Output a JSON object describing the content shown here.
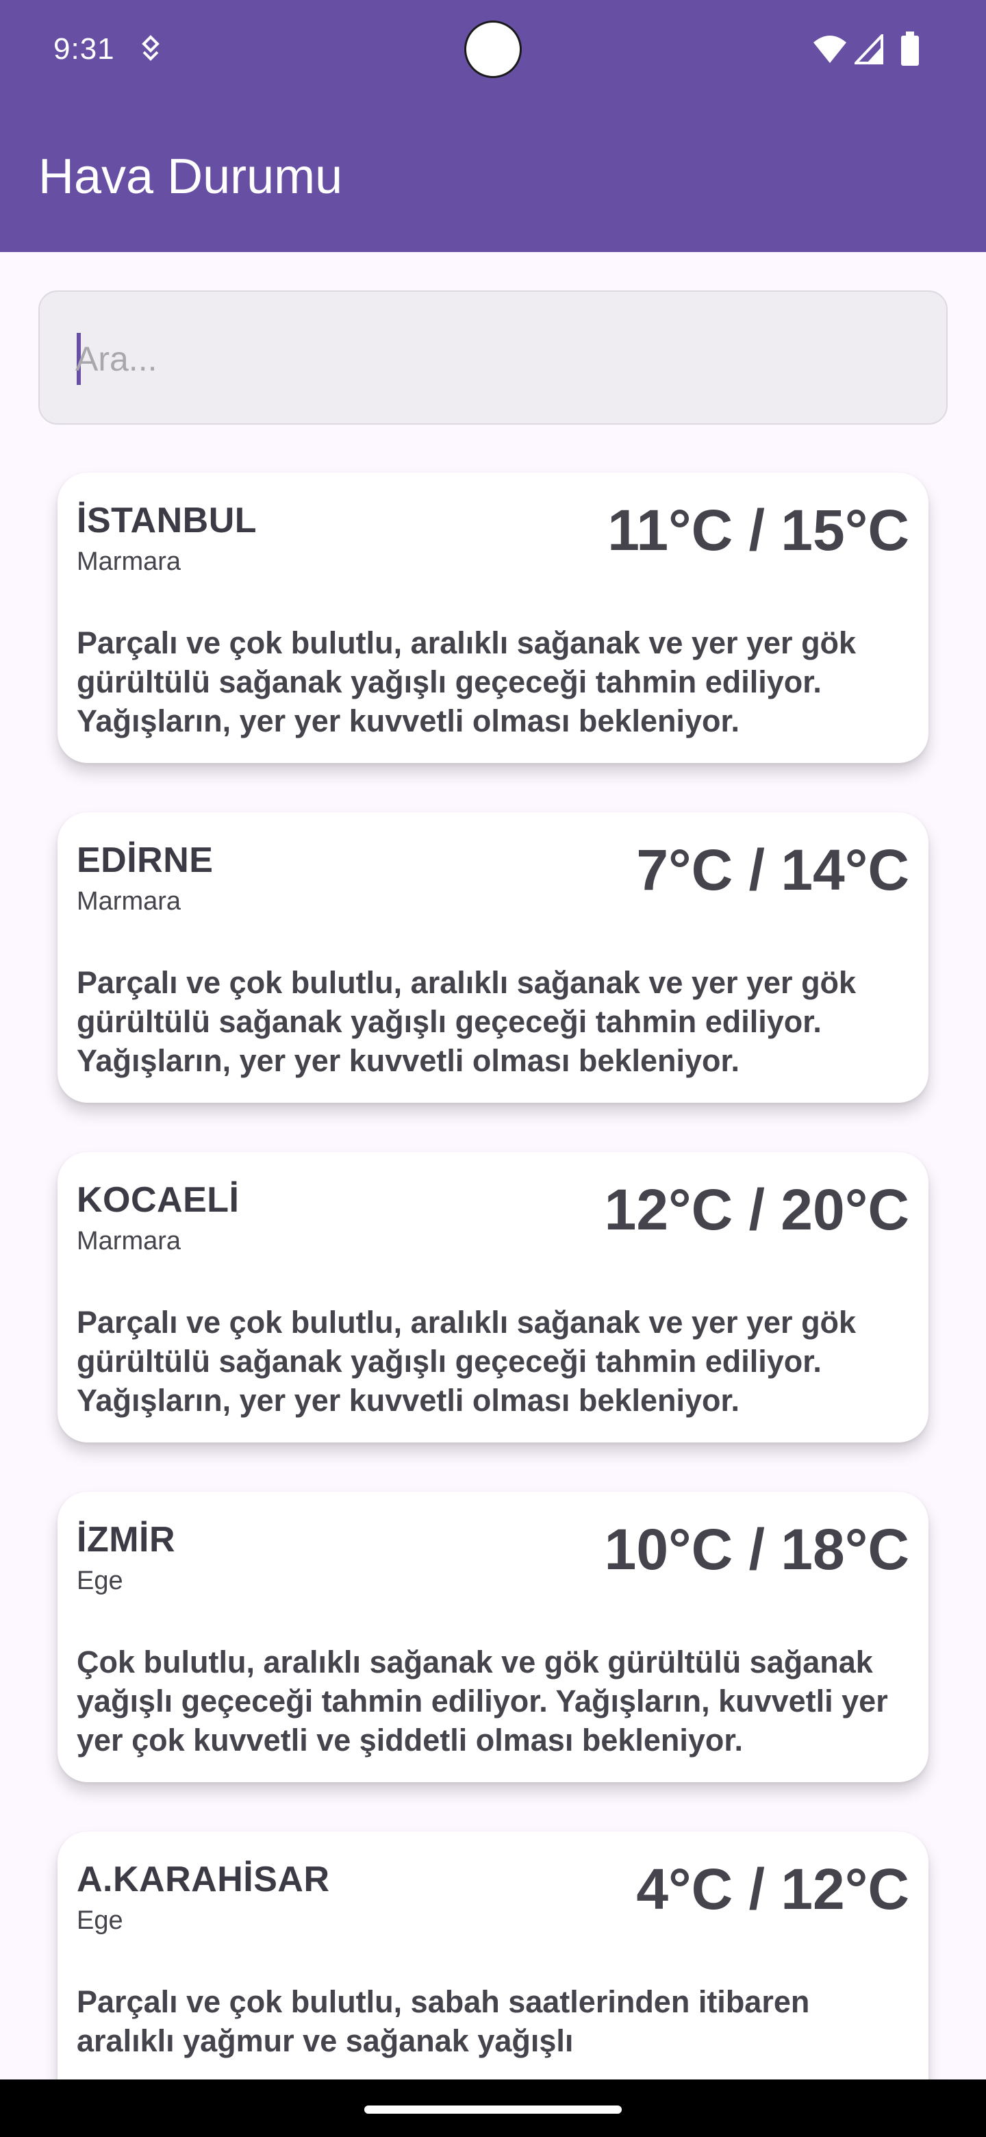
{
  "status_bar": {
    "time": "9:31",
    "icons": [
      "sync-icon",
      "wifi-icon",
      "signal-icon",
      "battery-icon"
    ]
  },
  "app_bar": {
    "title": "Hava Durumu",
    "color": "#6750a4"
  },
  "search": {
    "placeholder": "Ara...",
    "value": ""
  },
  "cities": [
    {
      "name": "İSTANBUL",
      "region": "Marmara",
      "temperature": "11°C / 15°C",
      "description": "Parçalı ve çok bulutlu, aralıklı sağanak ve yer yer gök gürültülü sağanak yağışlı geçeceği tahmin ediliyor. Yağışların, yer yer kuvvetli olması bekleniyor."
    },
    {
      "name": "EDİRNE",
      "region": "Marmara",
      "temperature": "7°C / 14°C",
      "description": "Parçalı ve çok bulutlu, aralıklı sağanak ve yer yer gök gürültülü sağanak yağışlı geçeceği tahmin ediliyor. Yağışların, yer yer kuvvetli olması bekleniyor."
    },
    {
      "name": "KOCAELİ",
      "region": "Marmara",
      "temperature": "12°C / 20°C",
      "description": "Parçalı ve çok bulutlu, aralıklı sağanak ve yer yer gök gürültülü sağanak yağışlı geçeceği tahmin ediliyor. Yağışların, yer yer kuvvetli olması bekleniyor."
    },
    {
      "name": "İZMİR",
      "region": "Ege",
      "temperature": "10°C / 18°C",
      "description": "Çok bulutlu, aralıklı sağanak ve gök gürültülü sağanak yağışlı geçeceği tahmin ediliyor. Yağışların, kuvvetli yer yer çok kuvvetli ve şiddetli olması bekleniyor."
    },
    {
      "name": "A.KARAHİSAR",
      "region": "Ege",
      "temperature": "4°C / 12°C",
      "description": "Parçalı ve çok bulutlu, sabah saatlerinden itibaren aralıklı yağmur ve sağanak yağışlı"
    }
  ]
}
